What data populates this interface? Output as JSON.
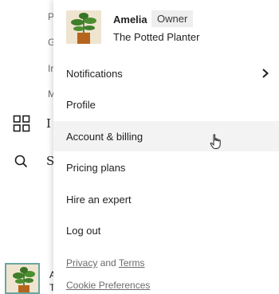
{
  "sidebar": {
    "sub_items": [
      "P",
      "G",
      "Ir",
      "M"
    ],
    "main_items": [
      {
        "icon": "grid-icon",
        "label": "I"
      },
      {
        "icon": "search-icon",
        "label": "S"
      }
    ],
    "account_initial_top": "A",
    "account_initial_bottom": "T",
    "avatar_icon": "plant-icon"
  },
  "menu": {
    "header": {
      "avatar_icon": "plant-icon",
      "name": "Amelia",
      "role_badge": "Owner",
      "store": "The Potted Planter"
    },
    "items": [
      {
        "label": "Notifications",
        "icon": "chevron-right-icon"
      },
      {
        "label": "Profile"
      },
      {
        "label": "Account & billing",
        "hovered": true
      },
      {
        "label": "Pricing plans"
      },
      {
        "label": "Hire an expert"
      },
      {
        "label": "Log out"
      }
    ],
    "footer": {
      "privacy": "Privacy",
      "and": "and",
      "terms": "Terms",
      "cookies": "Cookie Preferences"
    },
    "cursor_icon": "hand-pointer-icon"
  }
}
